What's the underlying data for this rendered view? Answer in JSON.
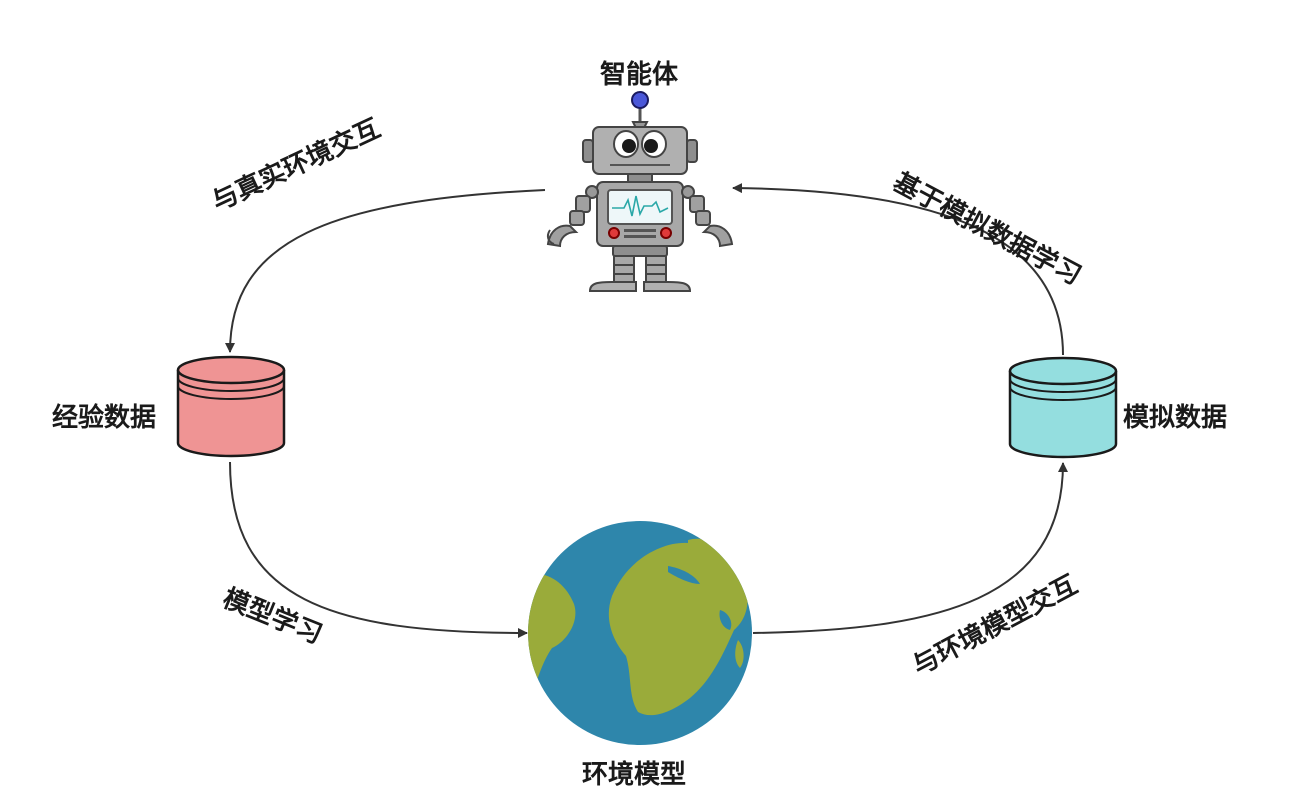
{
  "nodes": {
    "agent": "智能体",
    "experience_data": "经验数据",
    "simulated_data": "模拟数据",
    "environment_model": "环境模型"
  },
  "edges": {
    "real_env_interaction": "与真实环境交互",
    "sim_data_learning": "基于模拟数据学习",
    "model_learning": "模型学习",
    "env_model_interaction": "与环境模型交互"
  },
  "colors": {
    "experience_db": "#ef9494",
    "simulated_db": "#94dedf",
    "ocean": "#2e86ab",
    "land": "#9aab3a",
    "arrow": "#333333"
  }
}
